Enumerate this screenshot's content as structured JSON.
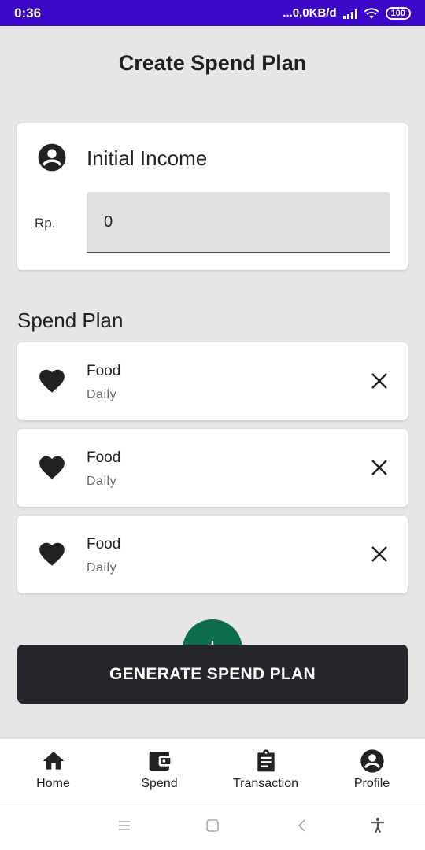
{
  "status_bar": {
    "time": "0:36",
    "network_speed": "...0,0KB/d",
    "battery": "100"
  },
  "header": {
    "title": "Create Spend Plan"
  },
  "income": {
    "title": "Initial Income",
    "currency": "Rp.",
    "value": "0",
    "icon": "account-circle-icon"
  },
  "spend_plan": {
    "title": "Spend Plan",
    "items": [
      {
        "name": "Food",
        "frequency": "Daily",
        "icon": "heart-icon"
      },
      {
        "name": "Food",
        "frequency": "Daily",
        "icon": "heart-icon"
      },
      {
        "name": "Food",
        "frequency": "Daily",
        "icon": "heart-icon"
      }
    ]
  },
  "actions": {
    "generate_label": "GENERATE SPEND PLAN",
    "add_icon": "add-icon"
  },
  "bottom_nav": {
    "items": [
      {
        "label": "Home",
        "icon": "home-icon"
      },
      {
        "label": "Spend",
        "icon": "wallet-icon"
      },
      {
        "label": "Transaction",
        "icon": "clipboard-icon"
      },
      {
        "label": "Profile",
        "icon": "account-circle-icon"
      }
    ]
  },
  "colors": {
    "status_bar": "#3a08c6",
    "background": "#e6e6e6",
    "fab": "#0d6b4e",
    "generate_button": "#25262b"
  }
}
